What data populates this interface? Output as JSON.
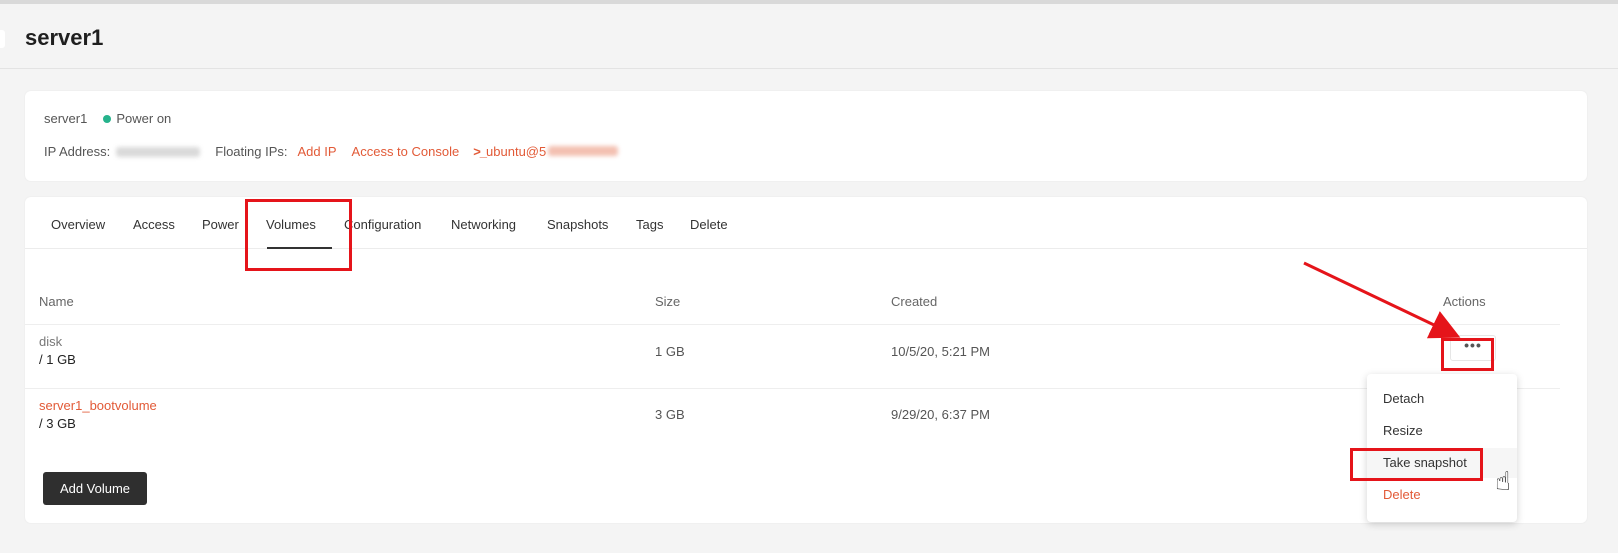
{
  "page": {
    "title": "server1"
  },
  "server_info": {
    "name": "server1",
    "status": "Power on",
    "ip_label": "IP Address:",
    "floating_label": "Floating IPs:",
    "add_ip": "Add IP",
    "console": "Access to Console",
    "ssh_prompt": ">_",
    "ssh_user": "ubuntu@",
    "ssh_host_visible": "5"
  },
  "tabs": [
    "Overview",
    "Access",
    "Power",
    "Volumes",
    "Configuration",
    "Networking",
    "Snapshots",
    "Tags",
    "Delete"
  ],
  "active_tab": "Volumes",
  "table": {
    "headers": {
      "name": "Name",
      "size": "Size",
      "created": "Created",
      "actions": "Actions"
    },
    "rows": [
      {
        "name": "disk",
        "sub": "/ 1 GB",
        "size": "1 GB",
        "created": "10/5/20, 5:21 PM"
      },
      {
        "name": "server1_bootvolume",
        "sub": "/ 3 GB",
        "size": "3 GB",
        "created": "9/29/20, 6:37 PM"
      }
    ]
  },
  "add_volume": "Add Volume",
  "actions_button": "•••",
  "menu": [
    "Detach",
    "Resize",
    "Take snapshot",
    "Delete"
  ],
  "colors": {
    "accent": "#e25a37",
    "status_green": "#26b38c",
    "highlight_red": "#e5141a"
  },
  "icons": {
    "cursor": "pointing-hand-icon",
    "status": "status-dot-icon",
    "more": "more-horizontal-icon"
  }
}
